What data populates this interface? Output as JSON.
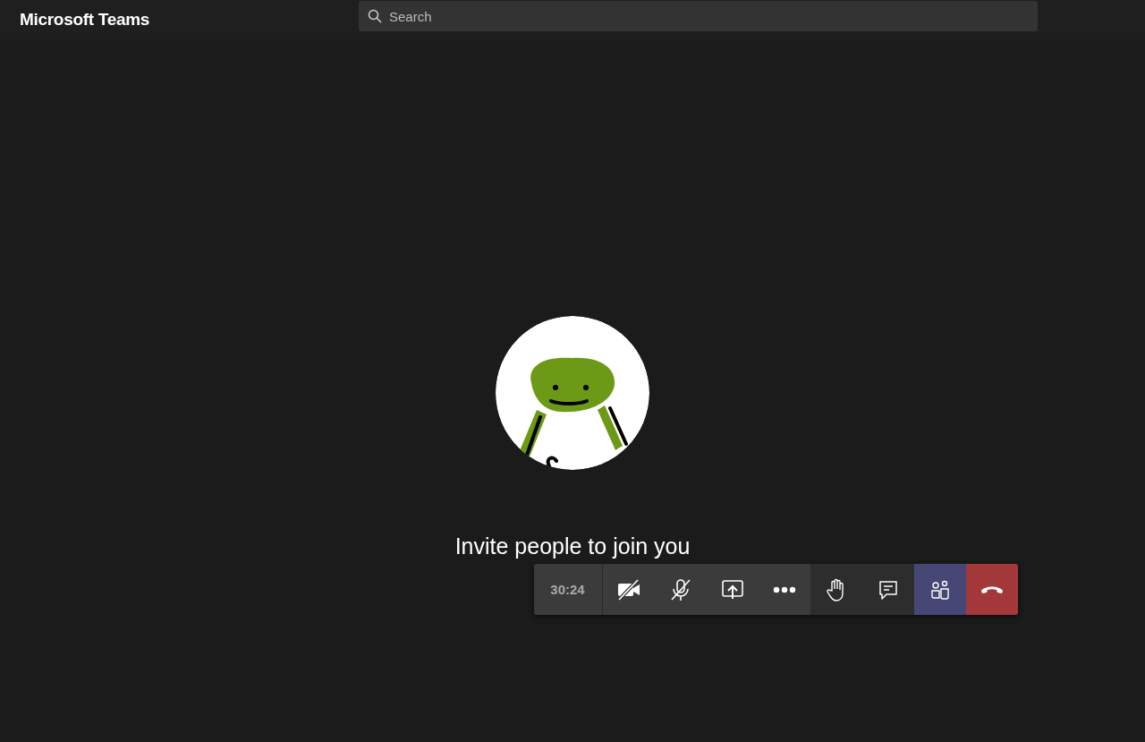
{
  "app": {
    "title": "Microsoft Teams"
  },
  "search": {
    "placeholder": "Search"
  },
  "call": {
    "invite_text": "Invite people to join you",
    "timer": "30:24",
    "controls": [
      {
        "kind": "camera",
        "on": false,
        "selected": false
      },
      {
        "kind": "mic",
        "on": false,
        "selected": false
      },
      {
        "kind": "share",
        "selected": false
      },
      {
        "kind": "more",
        "selected": false
      },
      {
        "kind": "hand",
        "selected": false
      },
      {
        "kind": "chat",
        "selected": false
      },
      {
        "kind": "participants",
        "selected": true
      },
      {
        "kind": "hangup",
        "selected": false
      }
    ]
  }
}
